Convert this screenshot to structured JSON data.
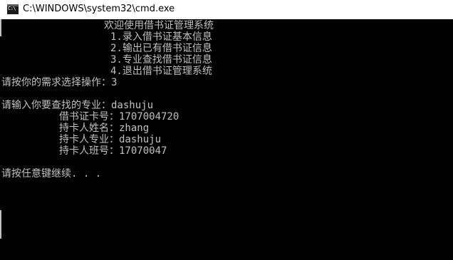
{
  "window": {
    "title": "C:\\WINDOWS\\system32\\cmd.exe",
    "icon": "cmd-console-icon",
    "icon_glyph": "C:\\"
  },
  "console": {
    "lines": {
      "welcome": "欢迎使用借书证管理系统",
      "menu1": "1.录入借书证基本信息",
      "menu2": "2.输出已有借书证信息",
      "menu3": "3.专业查找借书证信息",
      "menu4": "4.退出借书证管理系统",
      "choose": "请按你的需求选择操作：3",
      "input_major": "请输入你要查找的专业：dashuju",
      "card_no": "借书证卡号：1707004720",
      "holder_name": "持卡人姓名：zhang",
      "holder_major": "持卡人专业：dashuju",
      "holder_class": "持卡人班号：17070047",
      "press_any_key": "请按任意键继续. . ."
    }
  },
  "colors": {
    "console_bg": "#000000",
    "console_fg": "#c0c0c0",
    "titlebar_bg": "#ffffff"
  }
}
